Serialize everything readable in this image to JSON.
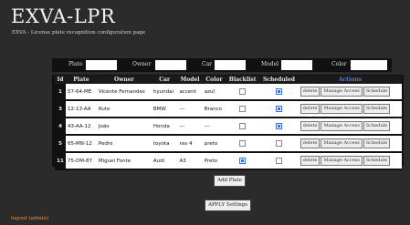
{
  "app": {
    "title": "EXVA-LPR",
    "subtitle": "EXVA - License plate recognition configuration page"
  },
  "filters": [
    {
      "label": "Plate",
      "value": ""
    },
    {
      "label": "Owner",
      "value": ""
    },
    {
      "label": "Car",
      "value": ""
    },
    {
      "label": "Model",
      "value": ""
    },
    {
      "label": "Color",
      "value": ""
    }
  ],
  "table": {
    "headers": {
      "id": "Id",
      "plate": "Plate",
      "owner": "Owner",
      "car": "Car",
      "model": "Model",
      "color": "Color",
      "blacklist": "Blacklist",
      "scheduled": "Scheduled",
      "actions": "Actions"
    },
    "rows": [
      {
        "id": "1",
        "plate": "57-64-ME",
        "owner": "Vicente Fernandes",
        "car": "hyundai",
        "model": "accent",
        "color": "azul",
        "blacklist": false,
        "scheduled": true
      },
      {
        "id": "3",
        "plate": "12-13-AA",
        "owner": "Rute",
        "car": "BMW",
        "model": "---",
        "color": "Branco",
        "blacklist": false,
        "scheduled": true
      },
      {
        "id": "4",
        "plate": "43-AA-12",
        "owner": "João",
        "car": "Honda",
        "model": "---",
        "color": "---",
        "blacklist": false,
        "scheduled": true
      },
      {
        "id": "5",
        "plate": "65-MN-12",
        "owner": "Pedro",
        "car": "toyota",
        "model": "rav 4",
        "color": "preto",
        "blacklist": false,
        "scheduled": false
      },
      {
        "id": "11",
        "plate": "75-DM-87",
        "owner": "Miguel Fonte",
        "car": "Audi",
        "model": "A3",
        "color": "Preto",
        "blacklist": true,
        "scheduled": false
      }
    ],
    "actions": {
      "delete": "delete",
      "manage_access": "Manage Access",
      "schedule": "Schedule"
    }
  },
  "buttons": {
    "add_plate": "Add Plate",
    "apply_settings": "APPLY Settings"
  },
  "footer": {
    "logout": "logout (admin)"
  },
  "colors": {
    "background": "#2b2b2b",
    "accent_checkbox": "#3a6fd8",
    "logout_link": "#e39b3a"
  }
}
